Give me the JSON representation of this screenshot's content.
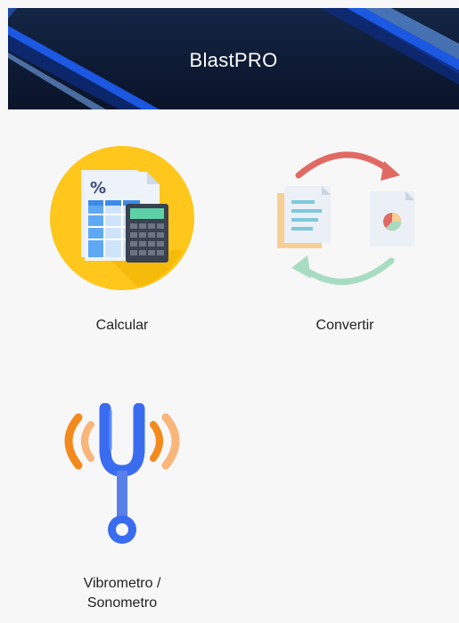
{
  "app": {
    "title": "BlastPRO"
  },
  "menu": {
    "items": [
      {
        "label": "Calcular",
        "icon": "calculator-spreadsheet-icon"
      },
      {
        "label": "Convertir",
        "icon": "document-convert-icon"
      },
      {
        "label": "Vibrometro / Sonometro",
        "label_line1": "Vibrometro /",
        "label_line2": "Sonometro",
        "icon": "tuning-fork-vibration-icon"
      }
    ]
  },
  "colors": {
    "header_bg": "#0e1b35",
    "header_accent": "#1f6bff",
    "background": "#f7f7f7",
    "calc_circle": "#ffc61b",
    "convert_red": "#e06a63",
    "convert_green": "#a8dcc0",
    "fork_blue": "#3a6cf0",
    "wave_orange": "#f28a1e"
  }
}
